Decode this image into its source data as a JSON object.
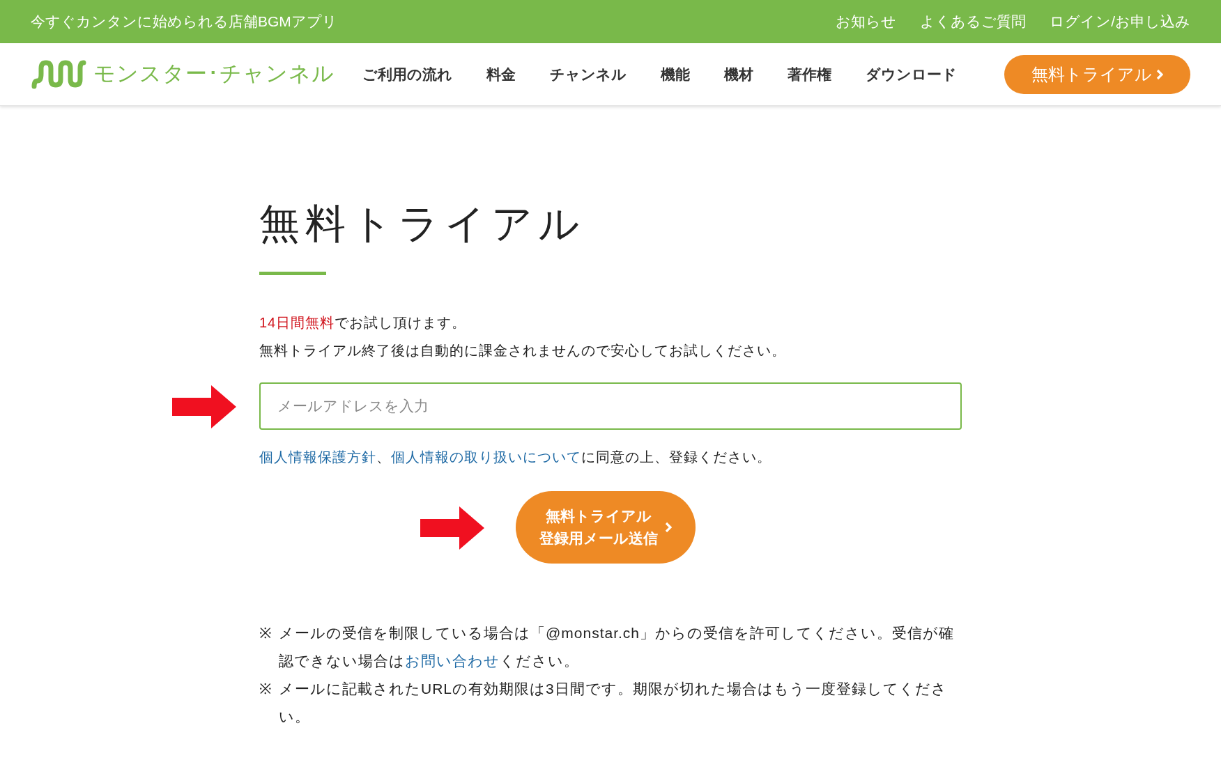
{
  "top_bar": {
    "tagline": "今すぐカンタンに始められる店舗BGMアプリ",
    "links": [
      "お知らせ",
      "よくあるご質問",
      "ログイン/お申し込み"
    ]
  },
  "nav": {
    "logo_text": "モンスター･チャンネル",
    "items": [
      "ご利用の流れ",
      "料金",
      "チャンネル",
      "機能",
      "機材",
      "著作権",
      "ダウンロード"
    ],
    "cta": "無料トライアル"
  },
  "page_title": "無料トライアル",
  "intro": [
    [
      {
        "kind": "highlight",
        "text": "14日間無料"
      },
      {
        "kind": "plain",
        "text": "でお試し頂けます。"
      }
    ],
    [
      {
        "kind": "plain",
        "text": "無料トライアル終了後は自動的に課金されませんので安心してお試しください。"
      }
    ]
  ],
  "email_field": {
    "placeholder": "メールアドレスを入力"
  },
  "consent": [
    {
      "kind": "link",
      "text": "個人情報保護方針"
    },
    {
      "kind": "plain",
      "text": "、"
    },
    {
      "kind": "link",
      "text": "個人情報の取り扱いについて"
    },
    {
      "kind": "plain",
      "text": "に同意の上、登録ください。"
    }
  ],
  "submit_button": [
    "無料トライアル",
    "登録用メール送信"
  ],
  "notes": [
    {
      "mark": "※",
      "parts": [
        {
          "kind": "plain",
          "text": "メールの受信を制限している場合は「@monstar.ch」からの受信を許可してください。受信が確認できない場合は"
        },
        {
          "kind": "link",
          "text": "お問い合わせ"
        },
        {
          "kind": "plain",
          "text": "ください。"
        }
      ]
    },
    {
      "mark": "※",
      "parts": [
        {
          "kind": "plain",
          "text": "メールに記載されたURLの有効期限は3日間です。期限が切れた場合はもう一度登録してください。"
        }
      ]
    }
  ]
}
